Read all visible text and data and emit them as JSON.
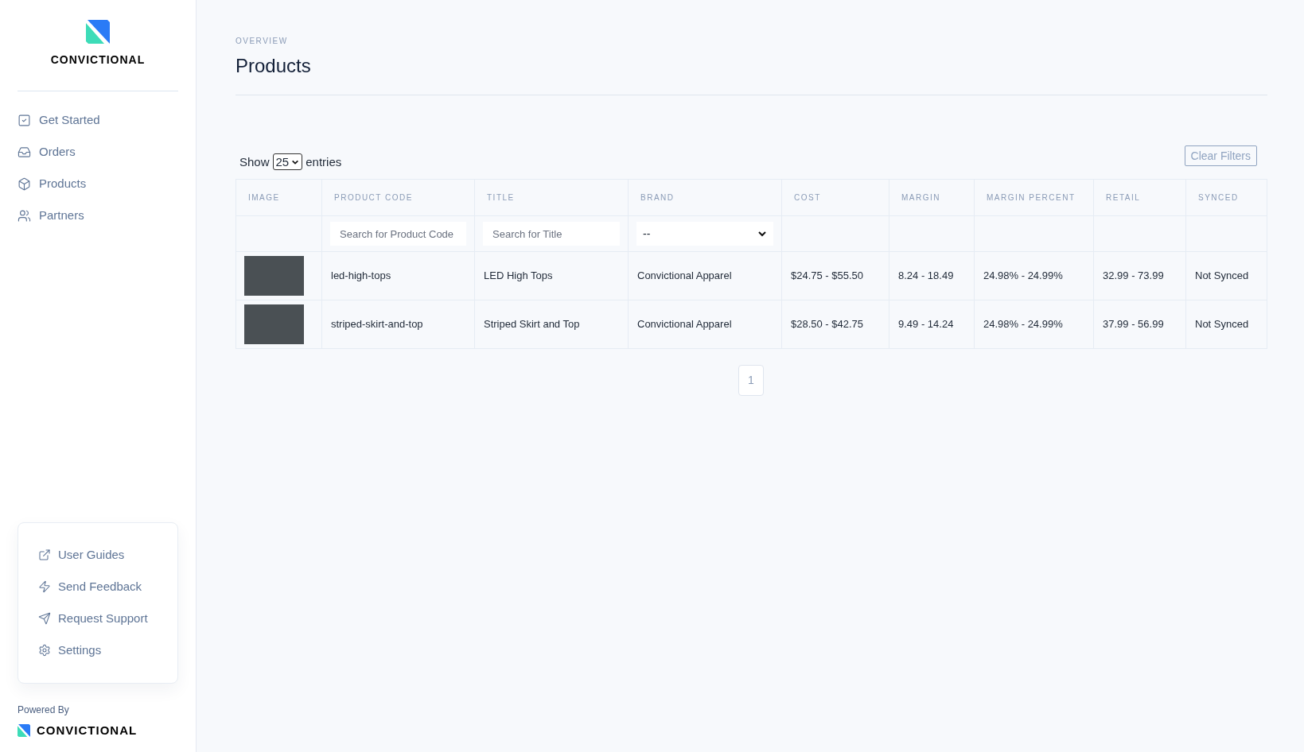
{
  "sidebar": {
    "brand": "CONVICTIONAL",
    "nav": [
      {
        "label": "Get Started"
      },
      {
        "label": "Orders"
      },
      {
        "label": "Products"
      },
      {
        "label": "Partners"
      }
    ],
    "help_links": [
      {
        "label": "User Guides"
      },
      {
        "label": "Send Feedback"
      },
      {
        "label": "Request Support"
      },
      {
        "label": "Settings"
      }
    ],
    "powered_by": "Powered By",
    "footer_brand": "CONVICTIONAL"
  },
  "page": {
    "eyebrow": "OVERVIEW",
    "title": "Products"
  },
  "controls": {
    "show_label": "Show",
    "page_size": "25",
    "entries_label": "entries",
    "clear_button": "Clear Filters"
  },
  "table": {
    "columns": [
      "IMAGE",
      "PRODUCT CODE",
      "TITLE",
      "BRAND",
      "COST",
      "MARGIN",
      "MARGIN PERCENT",
      "RETAIL",
      "SYNCED"
    ],
    "filters": [
      {
        "kind": "none"
      },
      {
        "kind": "text",
        "placeholder": "Search for Product Code"
      },
      {
        "kind": "text",
        "placeholder": "Search for Title"
      },
      {
        "kind": "select",
        "value": "--"
      },
      {
        "kind": "none"
      },
      {
        "kind": "none"
      },
      {
        "kind": "none"
      },
      {
        "kind": "none"
      },
      {
        "kind": "none"
      }
    ],
    "rows": [
      {
        "code": "led-high-tops",
        "title": "LED High Tops",
        "brand": "Convictional Apparel",
        "cost": "$24.75 - $55.50",
        "margin": "8.24 - 18.49",
        "margin_percent": "24.98% - 24.99%",
        "retail": "32.99 - 73.99",
        "synced": "Not Synced"
      },
      {
        "code": "striped-skirt-and-top",
        "title": "Striped Skirt and Top",
        "brand": "Convictional Apparel",
        "cost": "$28.50 - $42.75",
        "margin": "9.49 - 14.24",
        "margin_percent": "24.98% - 24.99%",
        "retail": "37.99 - 56.99",
        "synced": "Not Synced"
      }
    ]
  },
  "pagination": {
    "pages": [
      "1"
    ]
  }
}
